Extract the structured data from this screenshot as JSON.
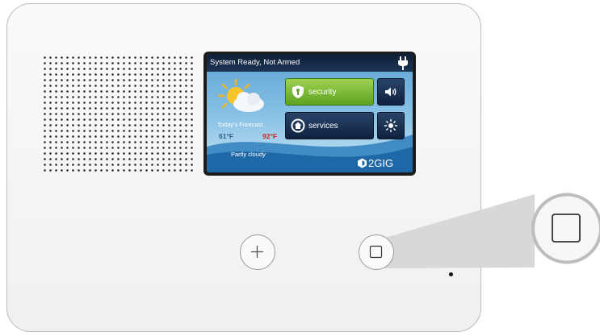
{
  "device": {
    "status_text": "System Ready, Not Armed",
    "weather": {
      "forecast_label": "Today's Forecast",
      "temp_low": "61°F",
      "temp_high": "92°F",
      "condition": "Partly cloudy"
    },
    "buttons": {
      "security_label": "security",
      "services_label": "services"
    },
    "brand": "2GIG"
  },
  "colors": {
    "security_green": "#6fb52a",
    "services_navy": "#1a3050",
    "status_bar": "#142a47",
    "screen_blue": "#7ab8e0",
    "temp_high_red": "#d6211f",
    "temp_low_blue": "#2c5f8a"
  },
  "icons": {
    "status": "power-plug-icon",
    "weather": "partly-cloudy-icon",
    "security": "shield-icon",
    "services": "home-refresh-icon",
    "volume": "speaker-volume-icon",
    "brightness": "brightness-icon",
    "brand": "2gig-logo-icon",
    "plus": "plus-icon",
    "home": "square-home-icon"
  }
}
